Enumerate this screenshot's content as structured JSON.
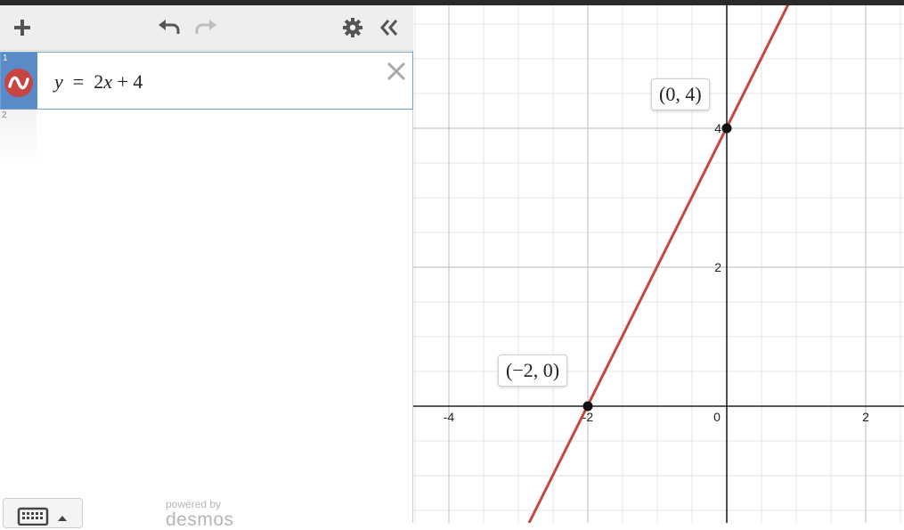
{
  "toolbar": {
    "add_icon": "plus-icon",
    "undo_icon": "undo-icon",
    "redo_icon": "redo-icon",
    "settings_icon": "gear-icon",
    "collapse_icon": "double-chevron-left-icon"
  },
  "expressions": [
    {
      "index": "1",
      "lhs": "y",
      "eq": "=",
      "rhs_coef": "2",
      "rhs_var": "x",
      "rhs_rest": " + 4",
      "color": "#c74440"
    },
    {
      "index": "2"
    }
  ],
  "footer": {
    "keyboard_icon": "keyboard-icon",
    "powered_by": "powered by",
    "brand": "desmos"
  },
  "graph": {
    "x_ticks": [
      "-4",
      "-2",
      "0",
      "2"
    ],
    "y_ticks": [
      "4",
      "2"
    ],
    "line_color": "#c74440",
    "points": [
      {
        "label": "(−2, 0)"
      },
      {
        "label": "(0, 4)"
      }
    ]
  }
}
